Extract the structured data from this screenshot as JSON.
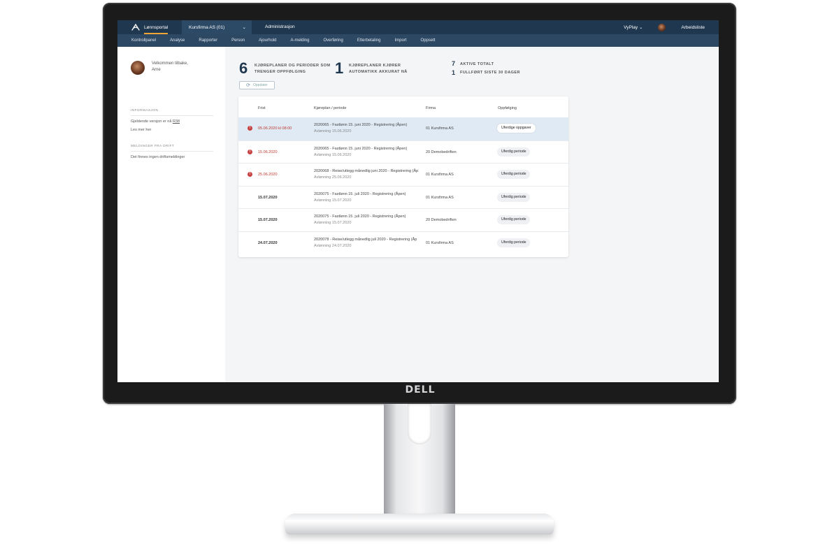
{
  "monitor": {
    "brand": "DELL"
  },
  "topbar": {
    "brand": "Lønnsportal",
    "company": "Kursfirma AS (01)",
    "admin": "Administrasjon",
    "user_menu": "VyPlay",
    "worklist": "Arbeidsliste"
  },
  "nav": [
    "Kontrollpanel",
    "Analyse",
    "Rapporter",
    "Person",
    "Ajourhold",
    "A-melding",
    "Overføring",
    "Etterbetaling",
    "Import",
    "Oppsett"
  ],
  "sidebar": {
    "welcome_line1": "Velkommen tilbake,",
    "welcome_line2": "Arne",
    "info_title": "INFORMASJON",
    "version_text": "Gjeldende versjon er nå ",
    "version_link": "R38",
    "read_more": "Les mer her",
    "ops_title": "MELDINGER FRA DRIFT",
    "ops_text": "Det finnes ingen driftsmeldinger"
  },
  "stats": {
    "attention_count": "6",
    "attention_label_1": "KJØREPLANER OG PERIODER SOM",
    "attention_label_2": "TRENGER OPPFØLGING",
    "running_count": "1",
    "running_label_1": "KJØREPLANER KJØRER",
    "running_label_2": "AUTOMATIKK AKKURAT NÅ",
    "active_count": "7",
    "active_label": "AKTIVE TOTALT",
    "completed_count": "1",
    "completed_label": "FULLFØRT SISTE 30 DAGER"
  },
  "refresh_label": "Oppdater",
  "table": {
    "headers": {
      "frist": "Frist",
      "plan": "Kjøreplan / periode",
      "firma": "Firma",
      "followup": "Oppfølging"
    },
    "rows": [
      {
        "frist": "05.06.2020 kl 08:00",
        "plan": "2020065 - Fastlønn 15. juni 2020  - Registrering  (Åpen)",
        "sub": "Avlønning 15.06.2020",
        "firma": "01 Kursfirma AS",
        "action": "Uferdige oppgaver"
      },
      {
        "frist": "15.06.2020",
        "plan": "2020065 - Fastlønn 15. juni 2020  - Registrering  (Åpen)",
        "sub": "Avlønning 15.06.2020",
        "firma": "20 Demobedriften",
        "action": "Uferdig periode"
      },
      {
        "frist": "25.06.2020",
        "plan": "2020068 - Reise/utlegg månedlig juni 2020  - Registrering  (Åp",
        "sub": "Avlønning 25.06.2020",
        "firma": "01 Kursfirma AS",
        "action": "Uferdig periode"
      },
      {
        "frist": "15.07.2020",
        "plan": "2020075 - Fastlønn 15. juli 2020  - Registrering  (Åpen)",
        "sub": "Avlønning 15.07.2020",
        "firma": "01 Kursfirma AS",
        "action": "Uferdig periode"
      },
      {
        "frist": "15.07.2020",
        "plan": "2020075 - Fastlønn 15. juli 2020  - Registrering  (Åpen)",
        "sub": "Avlønning 15.07.2020",
        "firma": "20 Demobedriften",
        "action": "Uferdig periode"
      },
      {
        "frist": "24.07.2020",
        "plan": "2020078 - Reise/utlegg månedlig juli 2020  - Registrering  (Åp",
        "sub": "Avlønning 24.07.2020",
        "firma": "01 Kursfirma AS",
        "action": "Uferdig periode"
      }
    ]
  }
}
